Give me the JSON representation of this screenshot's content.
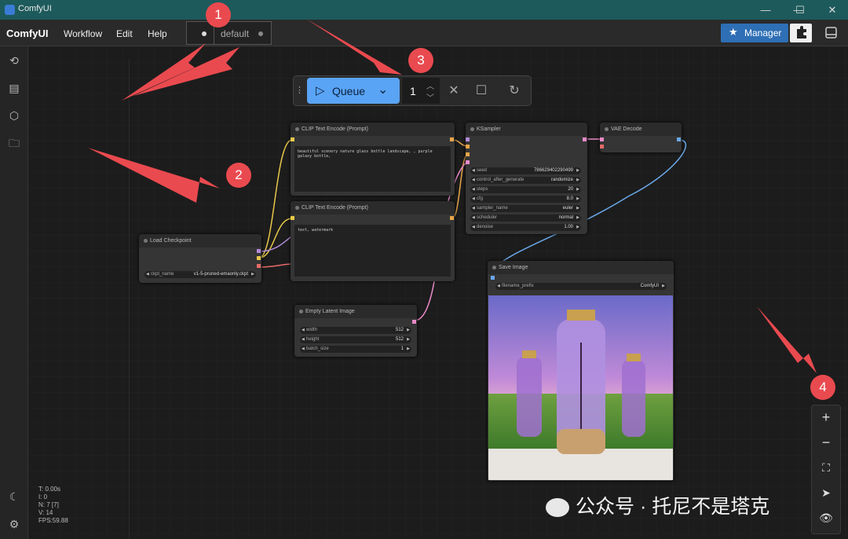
{
  "window": {
    "title": "ComfyUI"
  },
  "menubar": {
    "brand": "ComfyUI",
    "items": [
      "Workflow",
      "Edit",
      "Help"
    ],
    "tab_label": "default",
    "manager_label": "Manager"
  },
  "queue": {
    "button_label": "Queue",
    "count": "1"
  },
  "nodes": {
    "clip1": {
      "title": "CLIP Text Encode (Prompt)",
      "text": "beautiful scenery nature glass bottle landscape, , purple galaxy bottle,"
    },
    "clip2": {
      "title": "CLIP Text Encode (Prompt)",
      "text": "text, watermark"
    },
    "ksampler": {
      "title": "KSampler",
      "widgets": [
        {
          "label": "seed",
          "value": "786629402290499"
        },
        {
          "label": "control_after_generate",
          "value": "randomize"
        },
        {
          "label": "steps",
          "value": "20"
        },
        {
          "label": "cfg",
          "value": "8.0"
        },
        {
          "label": "sampler_name",
          "value": "euler"
        },
        {
          "label": "scheduler",
          "value": "normal"
        },
        {
          "label": "denoise",
          "value": "1.00"
        }
      ]
    },
    "vae": {
      "title": "VAE Decode"
    },
    "checkpoint": {
      "title": "Load Checkpoint",
      "ckpt_label": "ckpt_name",
      "ckpt_value": "v1-5-pruned-emaonly.ckpt"
    },
    "latent": {
      "title": "Empty Latent Image",
      "widgets": [
        {
          "label": "width",
          "value": "512"
        },
        {
          "label": "height",
          "value": "512"
        },
        {
          "label": "batch_size",
          "value": "1"
        }
      ]
    },
    "save": {
      "title": "Save Image",
      "prefix_label": "filename_prefix",
      "prefix_value": "ComfyUI"
    }
  },
  "stats": [
    "T: 0.00s",
    "I: 0",
    "N: 7 [7]",
    "V: 14",
    "FPS:59.88"
  ],
  "annotations": [
    "1",
    "2",
    "3",
    "4"
  ],
  "watermark": "公众号 · 托尼不是塔克",
  "colors": {
    "accent": "#5aa4f5",
    "badge": "#e94a4f",
    "manager": "#2e6fb5"
  }
}
